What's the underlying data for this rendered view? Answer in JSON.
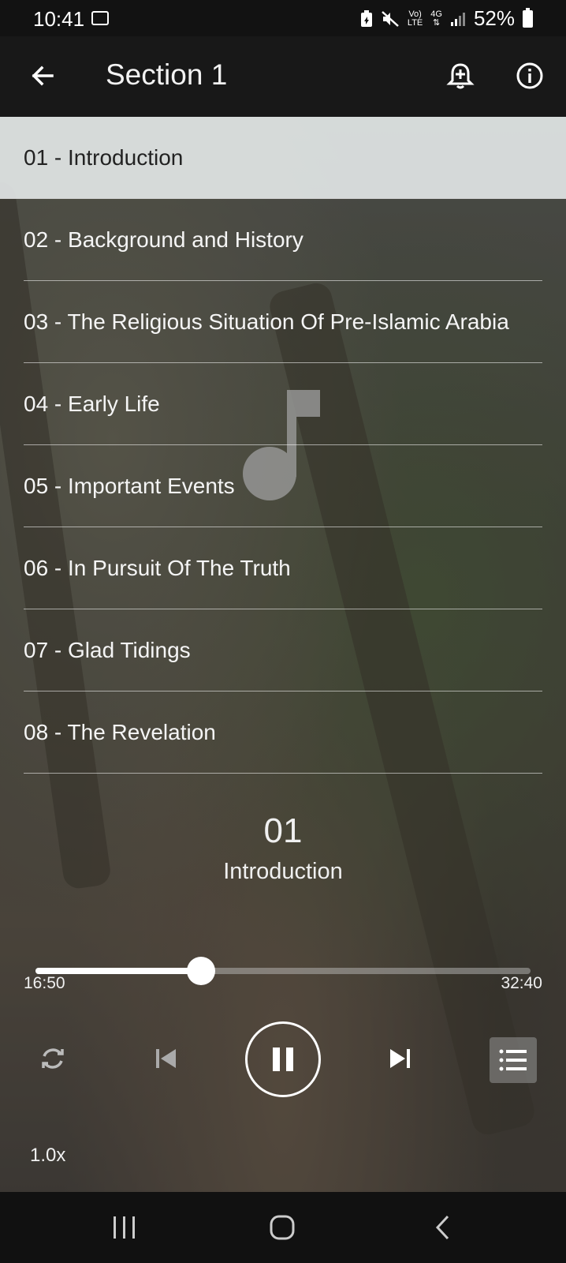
{
  "status_bar": {
    "time": "10:41",
    "network_top": "Vo)",
    "network_bottom": "LTE",
    "data_type": "4G",
    "battery": "52%"
  },
  "app_bar": {
    "title": "Section 1"
  },
  "tracks": [
    {
      "label": "01 - Introduction",
      "active": true
    },
    {
      "label": "02 - Background and History",
      "active": false
    },
    {
      "label": "03 - The Religious Situation Of Pre-Islamic Arabia",
      "active": false
    },
    {
      "label": "04 - Early Life",
      "active": false
    },
    {
      "label": "05 - Important Events",
      "active": false
    },
    {
      "label": "06 - In Pursuit Of The Truth",
      "active": false
    },
    {
      "label": "07 - Glad Tidings",
      "active": false
    },
    {
      "label": "08 - The Revelation",
      "active": false
    }
  ],
  "now_playing": {
    "number": "01",
    "title": "Introduction"
  },
  "player": {
    "elapsed": "16:50",
    "total": "32:40",
    "progress": 0.335,
    "speed": "1.0x"
  },
  "colors": {
    "app_bar": "#181818",
    "active_row": "#e2e6e6",
    "accent": "#ffffff"
  }
}
